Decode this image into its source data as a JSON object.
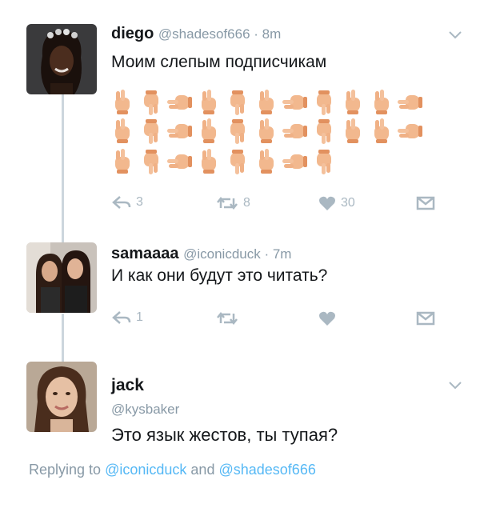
{
  "tweets": [
    {
      "name": "diego",
      "handle": "@shadesof666",
      "time": "8m",
      "text": "Моим слепым подписчикам",
      "emoji_rows": [
        11,
        11,
        8
      ],
      "reply_count": "3",
      "retweet_count": "8",
      "like_count": "30"
    },
    {
      "name": "samaaaa",
      "handle": "@iconicduck",
      "time": "7m",
      "text": "И как они будут это читать?",
      "reply_count": "1",
      "retweet_count": "",
      "like_count": ""
    },
    {
      "name": "jack",
      "handle": "@kysbaker",
      "text": "Это язык жестов, ты тупая?"
    }
  ],
  "replying": {
    "prefix": "Replying to",
    "user1": "@iconicduck",
    "and": "and",
    "user2": "@shadesof666"
  },
  "icons": {
    "reply": "reply-icon",
    "retweet": "retweet-icon",
    "like": "heart-icon",
    "dm": "direct-message-icon",
    "more": "chevron-down-icon"
  },
  "colors": {
    "muted": "#aab8c2",
    "link": "#1da1f2",
    "thread_line": "#ccd6dd"
  }
}
